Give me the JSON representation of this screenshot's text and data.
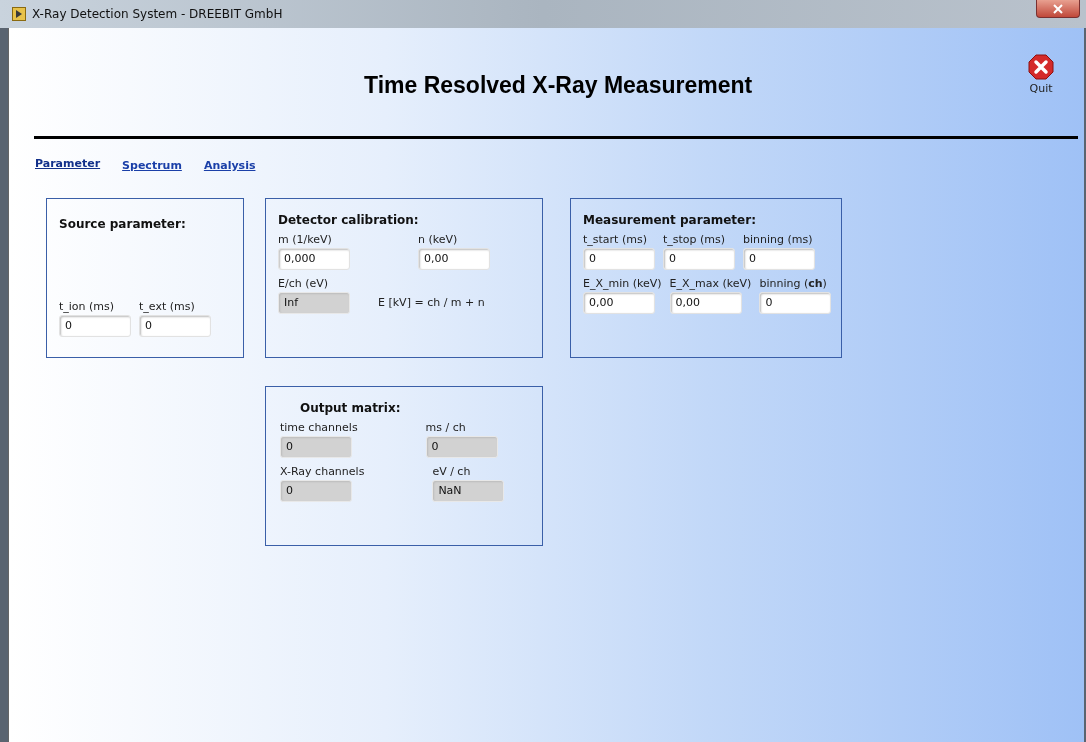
{
  "window": {
    "title": "X-Ray Detection System - DREEBIT GmbH"
  },
  "header": {
    "title": "Time Resolved X-Ray Measurement",
    "quit_label": "Quit"
  },
  "tabs": [
    {
      "label": "Parameter",
      "selected": true
    },
    {
      "label": "Spectrum",
      "selected": false
    },
    {
      "label": "Analysis",
      "selected": false
    }
  ],
  "panels": [
    {
      "title": "Source parameter:",
      "rows": [
        [
          {
            "kind": "field",
            "label": "t_ion (ms)",
            "value": "0",
            "readonly": false
          },
          {
            "kind": "field",
            "label": "t_ext (ms)",
            "value": "0",
            "readonly": false
          }
        ]
      ]
    },
    {
      "title": "Detector calibration:",
      "rows": [
        [
          {
            "kind": "field",
            "label": "m (1/keV)",
            "value": "0,000",
            "readonly": false
          },
          {
            "kind": "field",
            "label": "n (keV)",
            "value": "0,00",
            "readonly": false
          }
        ],
        [
          {
            "kind": "field",
            "label": "E/ch (eV)",
            "value": "Inf",
            "readonly": true
          },
          {
            "kind": "formula",
            "text": "E [kV] = ch / m + n"
          }
        ]
      ]
    },
    {
      "title": "Measurement parameter:",
      "rows": [
        [
          {
            "kind": "field",
            "label": "t_start (ms)",
            "value": "0",
            "readonly": false
          },
          {
            "kind": "field",
            "label": "t_stop (ms)",
            "value": "0",
            "readonly": false
          },
          {
            "kind": "field",
            "label": "binning (ms)",
            "value": "0",
            "readonly": false
          }
        ],
        [
          {
            "kind": "field",
            "label": "E_X_min (keV)",
            "value": "0,00",
            "readonly": false
          },
          {
            "kind": "field",
            "label": "E_X_max (keV)",
            "value": "0,00",
            "readonly": false
          },
          {
            "kind": "field",
            "label": "binning (**ch**)",
            "value": "0",
            "readonly": false
          }
        ]
      ]
    },
    {
      "title": "Output matrix:",
      "rows": [
        [
          {
            "kind": "field",
            "label": "time channels",
            "value": "0",
            "readonly": true
          },
          {
            "kind": "field",
            "label": "ms / ch",
            "value": "0",
            "readonly": true
          }
        ],
        [
          {
            "kind": "field",
            "label": "X-Ray channels",
            "value": "0",
            "readonly": true
          },
          {
            "kind": "field",
            "label": "eV / ch",
            "value": "NaN",
            "readonly": true
          }
        ]
      ]
    }
  ]
}
